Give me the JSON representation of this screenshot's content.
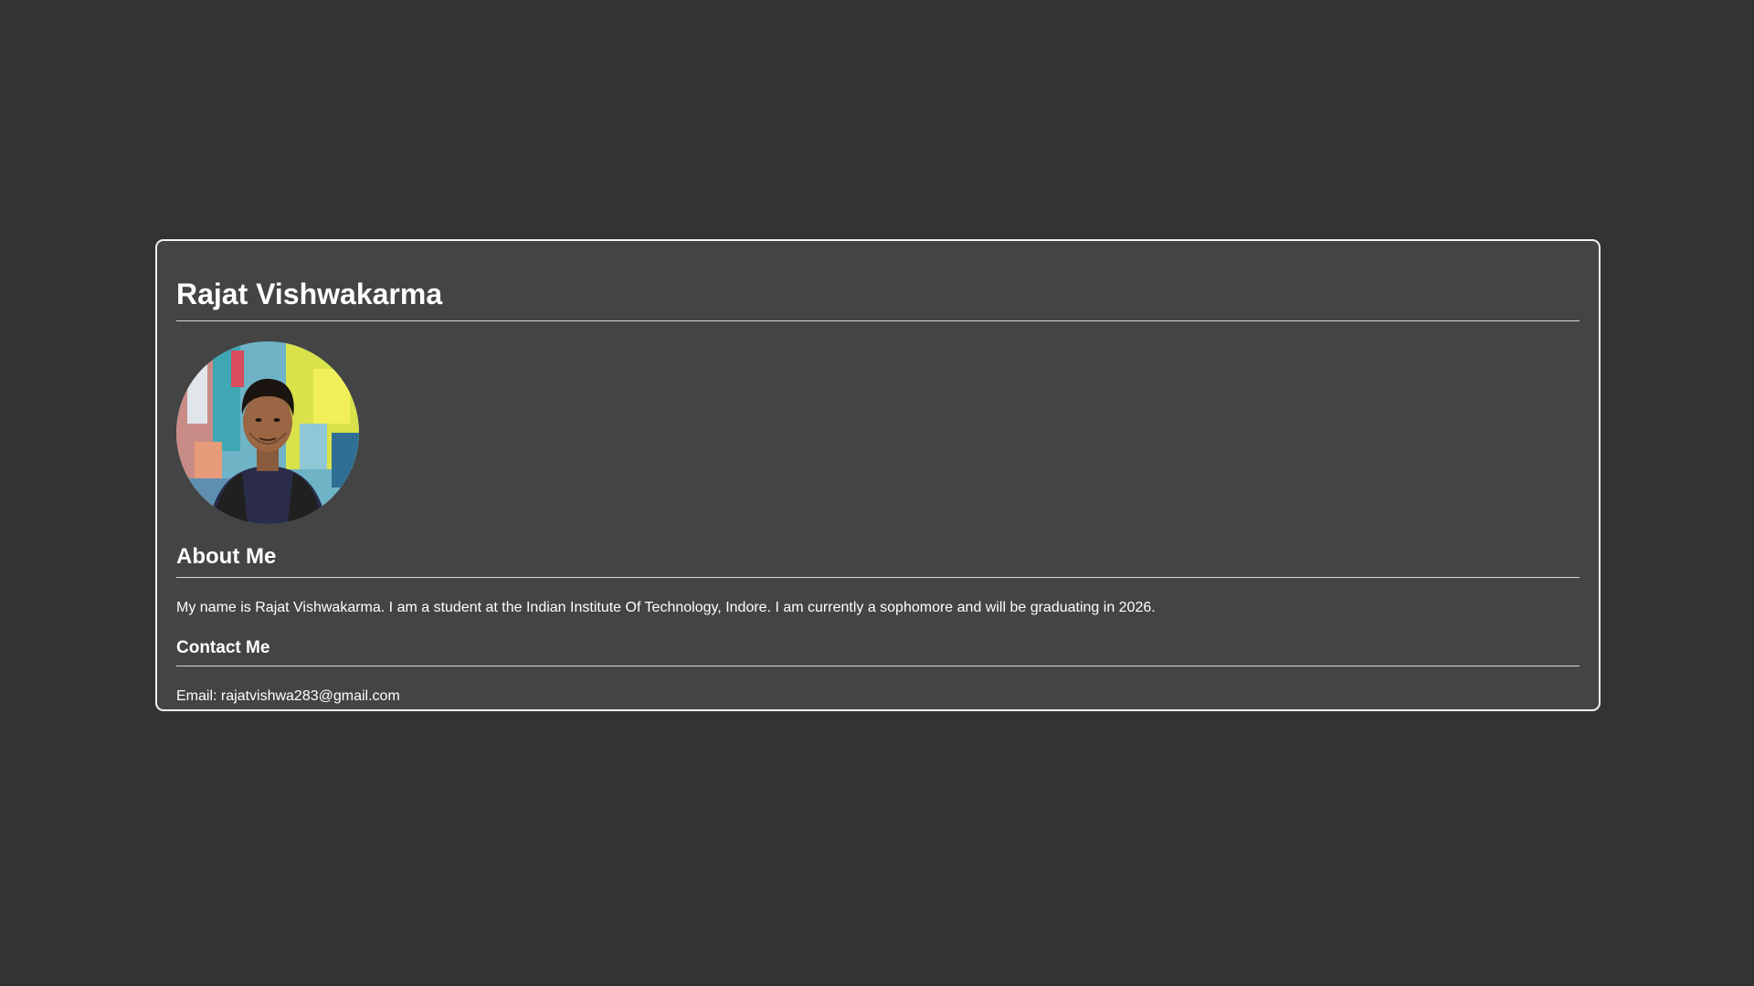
{
  "profile": {
    "name": "Rajat Vishwakarma",
    "avatar_icon": "profile-photo"
  },
  "about": {
    "heading": "About Me",
    "text": "My name is Rajat Vishwakarma. I am a student at the Indian Institute Of Technology, Indore. I am currently a sophomore and will be graduating in 2026."
  },
  "contact": {
    "heading": "Contact Me",
    "email": "Email: rajatvishwa283@gmail.com"
  },
  "colors": {
    "page_background": "#333333",
    "card_background": "#444444",
    "card_border": "#f2f2f2",
    "text": "#ffffff"
  }
}
